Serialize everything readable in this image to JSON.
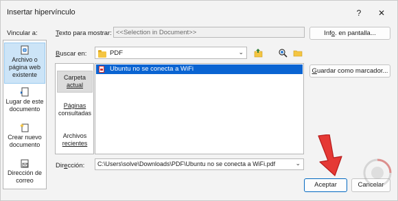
{
  "window": {
    "title": "Insertar hipervínculo",
    "help_glyph": "?",
    "close_glyph": "✕"
  },
  "link_to": {
    "label": "Vincular a:",
    "items": [
      {
        "label_line1": "Archivo o",
        "label_line2": "página web",
        "label_line3": "existente",
        "icon": "globe-page-icon",
        "selected": true
      },
      {
        "label_line1": "Lugar de este",
        "label_line2": "documento",
        "label_line3": "",
        "icon": "document-place-icon",
        "selected": false
      },
      {
        "label_line1": "Crear nuevo",
        "label_line2": "documento",
        "label_line3": "",
        "icon": "new-document-icon",
        "selected": false
      },
      {
        "label_line1": "Dirección de",
        "label_line2": "correo",
        "label_line3": "",
        "icon": "email-icon",
        "selected": false
      }
    ]
  },
  "text_to_display": {
    "label": "Texto para mostrar:",
    "value": "<<Selection in Document>>"
  },
  "screen_tip_button": "Info. en pantalla...",
  "look_in": {
    "label": "Buscar en:",
    "value": "PDF",
    "icons": [
      "up-folder-icon",
      "browse-web-icon",
      "browse-file-icon"
    ]
  },
  "left_nav": {
    "items": [
      {
        "line1": "Carpeta",
        "line2": "actual",
        "selected": true
      },
      {
        "line1": "Páginas",
        "line2": "consultadas",
        "selected": false
      },
      {
        "line1": "Archivos",
        "line2": "recientes",
        "selected": false
      }
    ]
  },
  "files": [
    {
      "name": "Ubuntu no se conecta a WiFi",
      "icon": "pdf-icon",
      "selected": true
    }
  ],
  "bookmark_button": "Guardar como marcador...",
  "address": {
    "label": "Dirección:",
    "value": "C:\\Users\\solve\\Downloads\\PDF\\Ubuntu no se conecta a WiFi.pdf"
  },
  "ok_button": "Aceptar",
  "cancel_button": "Cancelar",
  "colors": {
    "selection": "#0a64d2",
    "annotation_arrow": "#e53935",
    "ok_border": "#0067c0"
  }
}
